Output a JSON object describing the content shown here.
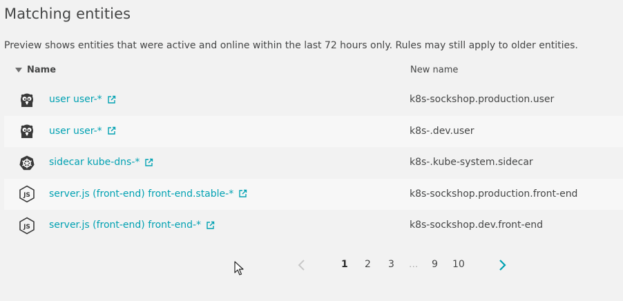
{
  "title": "Matching entities",
  "description": "Preview shows entities that were active and online within the last 72 hours only. Rules may still apply to older entities.",
  "columns": {
    "name": "Name",
    "new_name": "New name"
  },
  "rows": [
    {
      "icon": "go-gopher-icon",
      "name": "user user-*",
      "new_name": "k8s-sockshop.production.user"
    },
    {
      "icon": "go-gopher-icon",
      "name": "user user-*",
      "new_name": "k8s-.dev.user"
    },
    {
      "icon": "kubernetes-icon",
      "name": "sidecar kube-dns-*",
      "new_name": "k8s-.kube-system.sidecar"
    },
    {
      "icon": "nodejs-icon",
      "name": "server.js (front-end) front-end.stable-*",
      "new_name": "k8s-sockshop.production.front-end"
    },
    {
      "icon": "nodejs-icon",
      "name": "server.js (front-end) front-end-*",
      "new_name": "k8s-sockshop.dev.front-end"
    }
  ],
  "pagination": {
    "pages": [
      "1",
      "2",
      "3",
      "...",
      "9",
      "10"
    ],
    "current": "1"
  },
  "colors": {
    "link": "#00a1b2",
    "text": "#454646",
    "background": "#f2f2f2"
  }
}
